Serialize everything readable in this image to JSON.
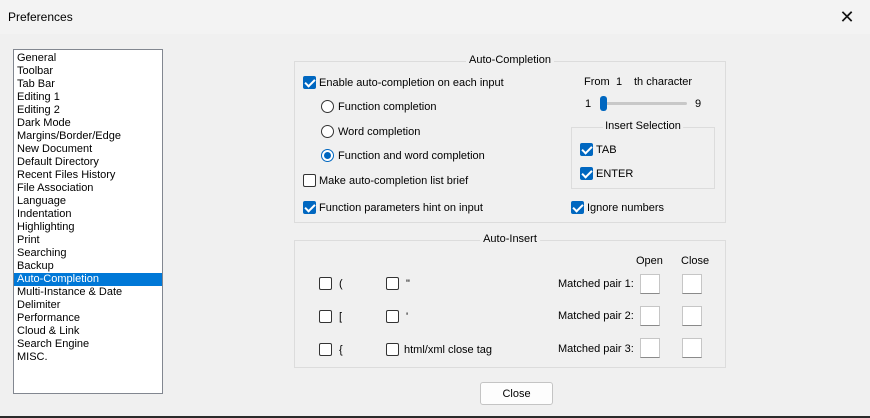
{
  "window": {
    "title": "Preferences",
    "close_glyph": "✕"
  },
  "categories": [
    "General",
    "Toolbar",
    "Tab Bar",
    "Editing 1",
    "Editing 2",
    "Dark Mode",
    "Margins/Border/Edge",
    "New Document",
    "Default Directory",
    "Recent Files History",
    "File Association",
    "Language",
    "Indentation",
    "Highlighting",
    "Print",
    "Searching",
    "Backup",
    "Auto-Completion",
    "Multi-Instance & Date",
    "Delimiter",
    "Performance",
    "Cloud & Link",
    "Search Engine",
    "MISC."
  ],
  "selected_category": "Auto-Completion",
  "auto_completion": {
    "legend": "Auto-Completion",
    "enable_label": "Enable auto-completion on each input",
    "enable_checked": true,
    "function_completion": "Function completion",
    "word_completion": "Word completion",
    "function_word_completion": "Function and word completion",
    "selected_mode": "function_word_completion",
    "brief_label": "Make auto-completion list brief",
    "brief_checked": false,
    "params_hint_label": "Function parameters hint on input",
    "params_hint_checked": true,
    "from_label": "From",
    "from_value": "1",
    "th_character_label": "th character",
    "slider_min": "1",
    "slider_max": "9",
    "slider_value": 1,
    "insert_selection": {
      "legend": "Insert Selection",
      "tab_label": "TAB",
      "tab_checked": true,
      "enter_label": "ENTER",
      "enter_checked": true
    },
    "ignore_numbers_label": "Ignore numbers",
    "ignore_numbers_checked": true
  },
  "auto_insert": {
    "legend": "Auto-Insert",
    "open_label": "Open",
    "close_label": "Close",
    "paren_label": "(",
    "bracket_label": "[",
    "brace_label": "{",
    "dquote_label": "\"",
    "squote_label": "'",
    "html_close_label": "html/xml close tag",
    "matched_pair_1": "Matched pair 1:",
    "matched_pair_2": "Matched pair 2:",
    "matched_pair_3": "Matched pair 3:"
  },
  "buttons": {
    "close_label": "Close"
  },
  "colors": {
    "accent": "#0067c0",
    "selection": "#0078d7"
  }
}
